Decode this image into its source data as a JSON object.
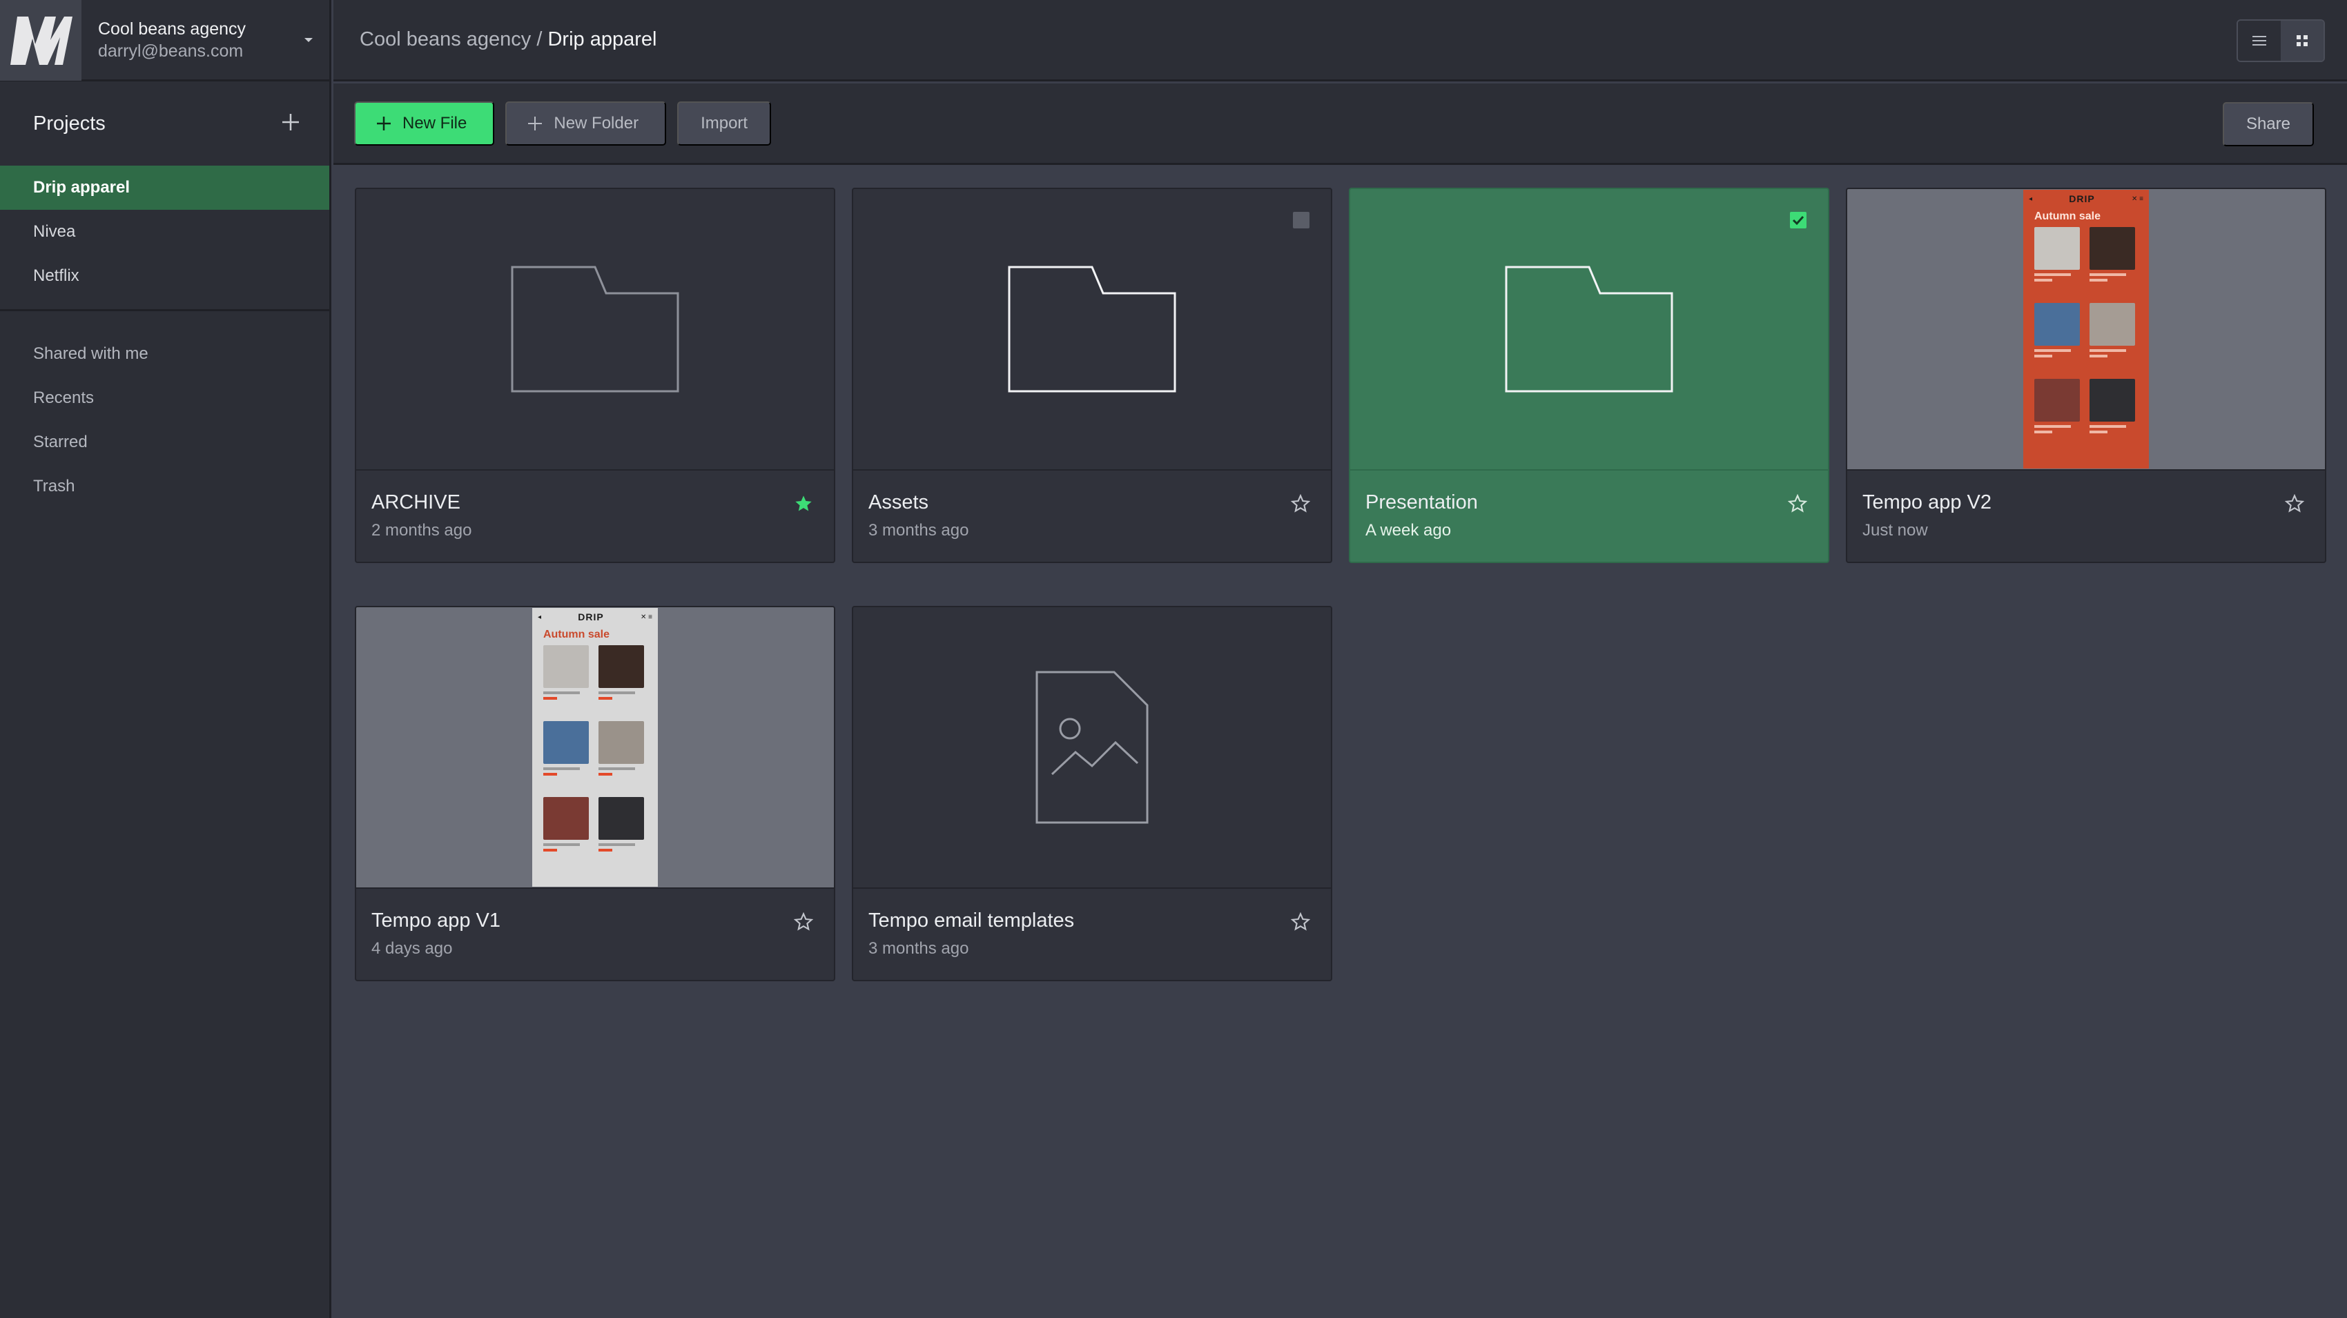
{
  "account": {
    "name": "Cool beans agency",
    "email": "darryl@beans.com",
    "logo_icon": "app-logo",
    "caret_icon": "caret-down-icon"
  },
  "projects": {
    "title": "Projects",
    "add_icon": "plus-icon",
    "items": [
      {
        "label": "Drip apparel",
        "active": true
      },
      {
        "label": "Nivea",
        "active": false
      },
      {
        "label": "Netflix",
        "active": false
      }
    ]
  },
  "nav": {
    "items": [
      {
        "label": "Shared with me"
      },
      {
        "label": "Recents"
      },
      {
        "label": "Starred"
      },
      {
        "label": "Trash"
      }
    ]
  },
  "breadcrumb": {
    "parent": "Cool beans agency",
    "separator": " / ",
    "current": "Drip apparel"
  },
  "view_toggle": {
    "list_icon": "list-view-icon",
    "grid_icon": "grid-view-icon",
    "active": "grid"
  },
  "toolbar": {
    "new_file_label": "New File",
    "new_folder_label": "New Folder",
    "import_label": "Import",
    "share_label": "Share"
  },
  "files": [
    {
      "title": "ARCHIVE",
      "date": "2 months ago",
      "type": "folder",
      "starred": true,
      "selected": false,
      "checkbox": "none"
    },
    {
      "title": "Assets",
      "date": "3 months ago",
      "type": "folder",
      "starred": false,
      "selected": false,
      "checkbox": "unchecked"
    },
    {
      "title": "Presentation",
      "date": "A week ago",
      "type": "folder",
      "starred": false,
      "selected": true,
      "checkbox": "checked"
    },
    {
      "title": "Tempo app V2",
      "date": "Just now",
      "type": "preview-orange",
      "starred": false,
      "selected": false,
      "checkbox": "none"
    },
    {
      "title": "Tempo app V1",
      "date": "4 days ago",
      "type": "preview-light",
      "starred": false,
      "selected": false,
      "checkbox": "none"
    },
    {
      "title": "Tempo email templates",
      "date": "3 months ago",
      "type": "image",
      "starred": false,
      "selected": false,
      "checkbox": "none"
    }
  ],
  "preview": {
    "logo": "DRIP",
    "heading": "Autumn sale"
  },
  "colors": {
    "accent": "#3ddc76",
    "selected": "#3a7a58",
    "sidebar_active": "#2f6b47",
    "preview_orange": "#c94a2d"
  }
}
